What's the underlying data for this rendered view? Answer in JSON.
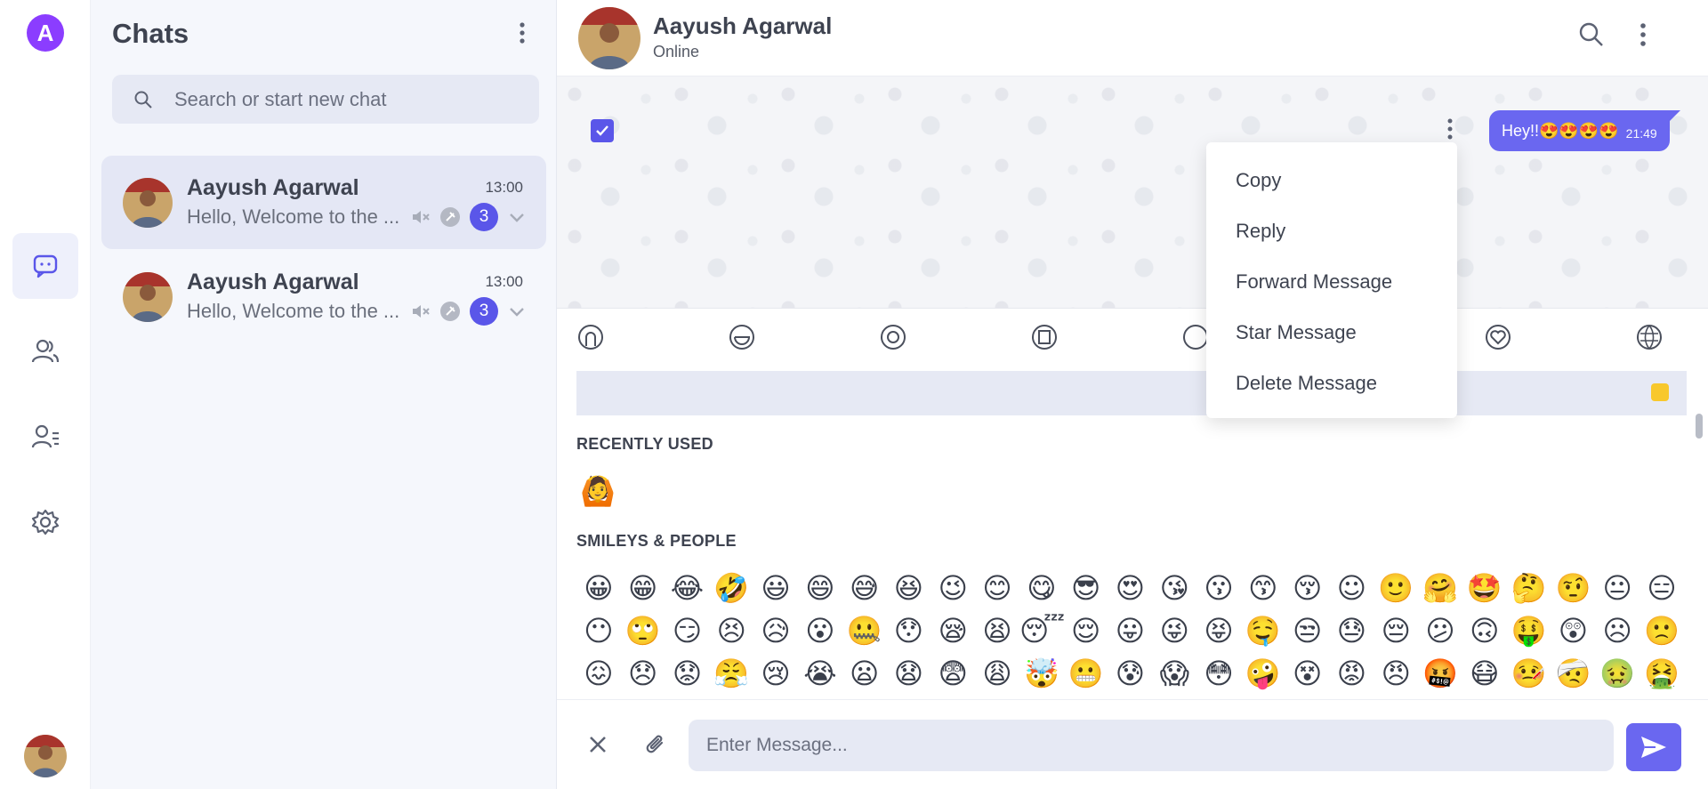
{
  "app": {
    "logo_letter": "A",
    "accent": "#5a56e9"
  },
  "rail": {
    "items": [
      {
        "icon": "chat-icon",
        "active": true
      },
      {
        "icon": "contacts-icon",
        "active": false
      },
      {
        "icon": "contact-list-icon",
        "active": false
      },
      {
        "icon": "settings-icon",
        "active": false
      }
    ]
  },
  "chat_list": {
    "title": "Chats",
    "search_placeholder": "Search or start new chat",
    "items": [
      {
        "name": "Aayush Agarwal",
        "time": "13:00",
        "preview": "Hello, Welcome to the ...",
        "unread": "3",
        "muted": true,
        "pinned": true
      },
      {
        "name": "Aayush Agarwal",
        "time": "13:00",
        "preview": "Hello, Welcome to the ...",
        "unread": "3",
        "muted": true,
        "pinned": true
      }
    ]
  },
  "conversation": {
    "name": "Aayush Agarwal",
    "status": "Online",
    "message": {
      "text": "Hey!!😍😍😍😍",
      "time": "21:49"
    }
  },
  "context_menu": {
    "items": [
      "Copy",
      "Reply",
      "Forward Message",
      "Star Message",
      "Delete Message"
    ]
  },
  "emoji_picker": {
    "categories": [
      "people-icon",
      "food-icon",
      "activity-icon",
      "travel-icon",
      "objects-icon",
      "symbols-icon",
      "flags-icon"
    ],
    "recent_label": "RECENTLY USED",
    "recent": [
      "🙆"
    ],
    "smileys_label": "SMILEYS & PEOPLE",
    "rows": [
      [
        "😀",
        "😁",
        "😂",
        "🤣",
        "😃",
        "😄",
        "😅",
        "😆",
        "😉",
        "😊",
        "😋",
        "😎",
        "😍",
        "😘",
        "😗",
        "😙",
        "😚",
        "☺",
        "🙂",
        "🤗",
        "🤩",
        "🤔",
        "🤨",
        "😐",
        "😑"
      ],
      [
        "😶",
        "🙄",
        "😏",
        "😣",
        "😥",
        "😮",
        "🤐",
        "😯",
        "😪",
        "😫",
        "😴",
        "😌",
        "😛",
        "😜",
        "😝",
        "🤤",
        "😒",
        "😓",
        "😔",
        "😕",
        "🙃",
        "🤑",
        "😲",
        "☹",
        "🙁"
      ],
      [
        "😖",
        "😞",
        "😟",
        "😤",
        "😢",
        "😭",
        "😦",
        "😧",
        "😨",
        "😩",
        "🤯",
        "😬",
        "😰",
        "😱",
        "😳",
        "🤪",
        "😵",
        "😡",
        "😠",
        "🤬",
        "😷",
        "🤒",
        "🤕",
        "🤢",
        "🤮"
      ]
    ]
  },
  "composer": {
    "placeholder": "Enter Message..."
  }
}
